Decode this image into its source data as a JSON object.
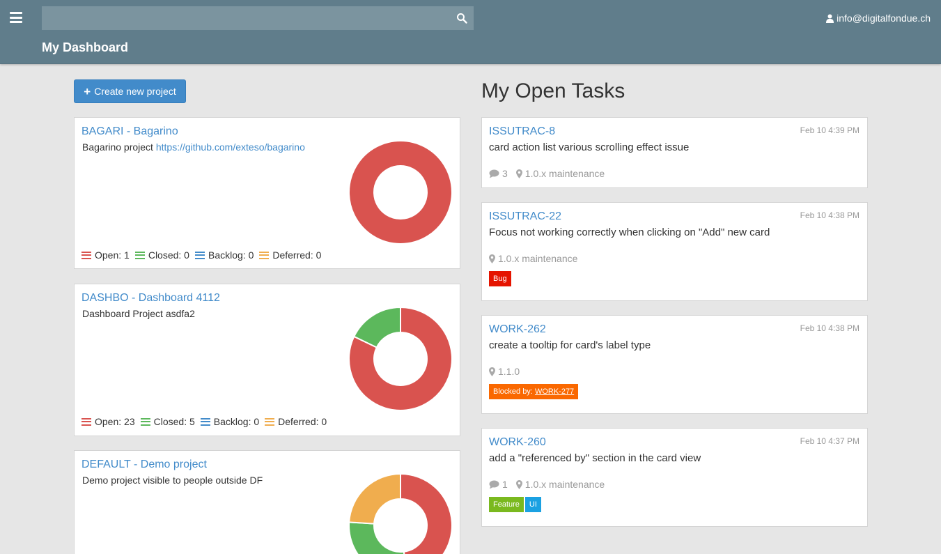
{
  "header": {
    "search": {
      "placeholder": "",
      "value": ""
    },
    "user_email": "info@digitalfondue.ch",
    "page_title": "My Dashboard"
  },
  "create_button": {
    "label": "Create new project"
  },
  "projects": [
    {
      "title": "BAGARI - Bagarino",
      "description": "Bagarino project",
      "link": "https://github.com/exteso/bagarino",
      "stats": {
        "open": "Open: 1",
        "closed": "Closed: 0",
        "backlog": "Backlog: 0",
        "deferred": "Deferred: 0"
      },
      "counts": {
        "open": 1,
        "closed": 0,
        "backlog": 0,
        "deferred": 0
      }
    },
    {
      "title": "DASHBO - Dashboard 4112",
      "description": "Dashboard Project asdfa2",
      "link": "",
      "stats": {
        "open": "Open: 23",
        "closed": "Closed: 5",
        "backlog": "Backlog: 0",
        "deferred": "Deferred: 0"
      },
      "counts": {
        "open": 23,
        "closed": 5,
        "backlog": 0,
        "deferred": 0
      }
    },
    {
      "title": "DEFAULT - Demo project",
      "description": "Demo project visible to people outside DF",
      "link": "",
      "stats": {
        "open": "",
        "closed": "",
        "backlog": "",
        "deferred": ""
      },
      "counts": {
        "open": 12,
        "closed": 7,
        "backlog": 0,
        "deferred": 6
      }
    }
  ],
  "tasks_heading": "My Open Tasks",
  "tasks": [
    {
      "id": "ISSUTRAC-8",
      "time": "Feb 10 4:39 PM",
      "title": "card action list various scrolling effect issue",
      "comments": "3",
      "milestone": "1.0.x maintenance",
      "labels": []
    },
    {
      "id": "ISSUTRAC-22",
      "time": "Feb 10 4:38 PM",
      "title": "Focus not working correctly when clicking on \"Add\" new card",
      "comments": "",
      "milestone": "1.0.x maintenance",
      "labels": [
        {
          "text": "Bug",
          "link": "",
          "color": "#e51400"
        }
      ]
    },
    {
      "id": "WORK-262",
      "time": "Feb 10 4:38 PM",
      "title": "create a tooltip for card's label type",
      "comments": "",
      "milestone": "1.1.0",
      "labels": [
        {
          "text": "Blocked by:",
          "link": "WORK-277",
          "color": "#fa6800"
        }
      ]
    },
    {
      "id": "WORK-260",
      "time": "Feb 10 4:37 PM",
      "title": "add a \"referenced by\" section in the card view",
      "comments": "1",
      "milestone": "1.0.x maintenance",
      "labels": [
        {
          "text": "Feature",
          "link": "",
          "color": "#7ab91f"
        },
        {
          "text": "UI",
          "link": "",
          "color": "#1ba1e2"
        }
      ]
    }
  ],
  "colors": {
    "topbar": "#607d8b",
    "accent": "#428bca",
    "open": "#d9534f",
    "closed": "#5cb85c",
    "backlog": "#428bca",
    "deferred": "#f0ad4e"
  },
  "icons": [
    "menu-icon",
    "search-icon",
    "user-icon",
    "plus-icon",
    "comment-icon",
    "map-marker-icon",
    "status-list-icon"
  ]
}
